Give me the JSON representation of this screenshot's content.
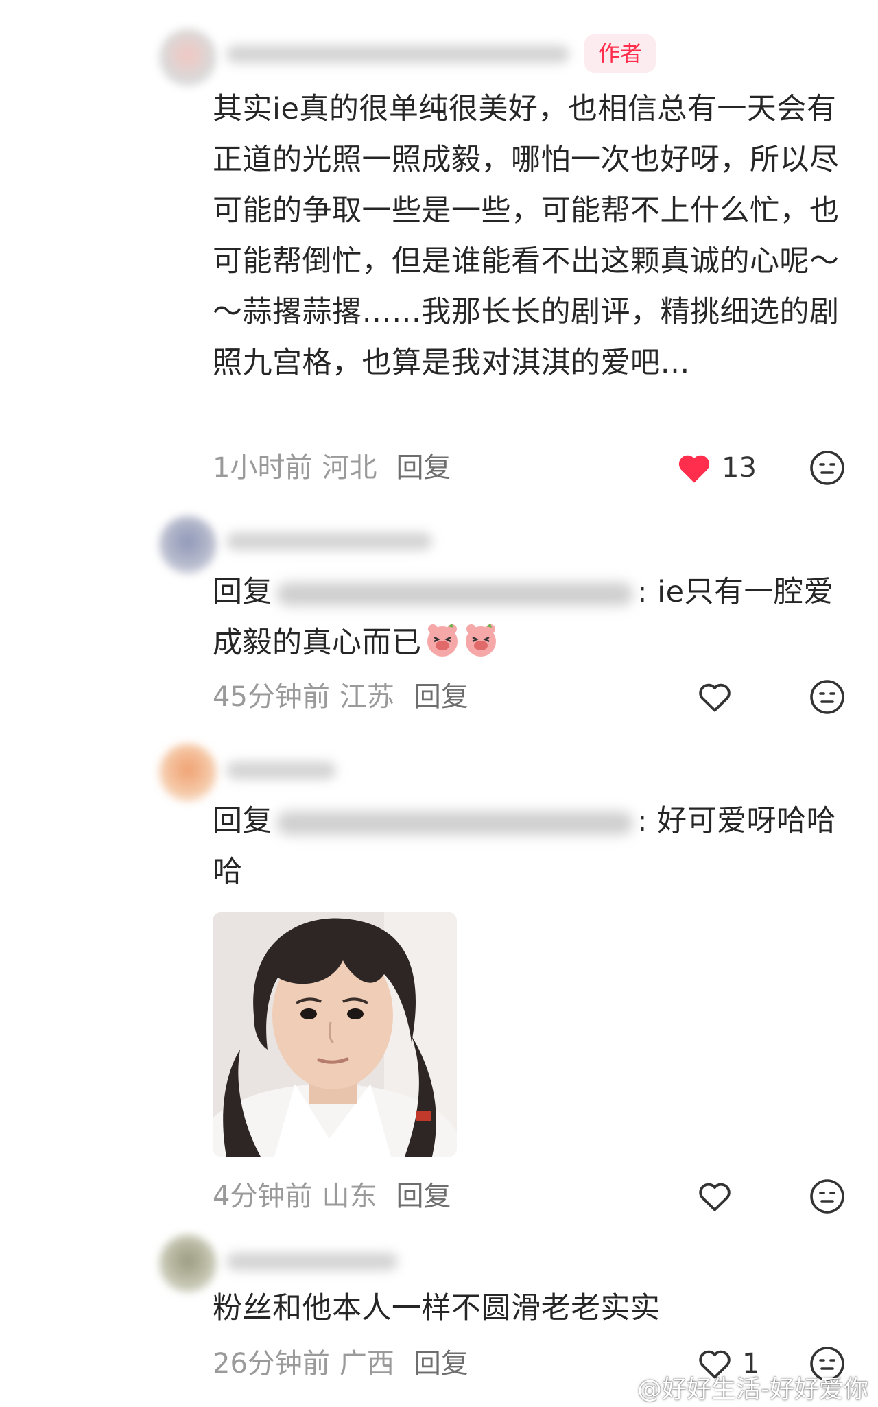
{
  "comments": [
    {
      "badge": "作者",
      "text": "其实ie真的很单纯很美好，也相信总有一天会有正道的光照一照成毅，哪怕一次也好呀，所以尽可能的争取一些是一些，可能帮不上什么忙，也可能帮倒忙，但是谁能看不出这颗真诚的心呢～～蒜撂蒜撂……我那长长的剧评，精挑细选的剧照九宫格，也算是我对淇淇的爱吧…",
      "time": "1小时前",
      "location": "河北",
      "reply_label": "回复",
      "likes": "13",
      "liked": true
    },
    {
      "reply_prefix": "回复",
      "text": ": ie只有一腔爱成毅的真心而已",
      "time": "45分钟前",
      "location": "江苏",
      "reply_label": "回复",
      "likes": "",
      "liked": false
    },
    {
      "reply_prefix": "回复",
      "text": ": 好可爱呀哈哈哈",
      "time": "4分钟前",
      "location": "山东",
      "reply_label": "回复",
      "likes": "",
      "liked": false
    },
    {
      "text": "粉丝和他本人一样不圆滑老老实实",
      "time": "26分钟前",
      "location": "广西",
      "reply_label": "回复",
      "likes": "1",
      "liked": false
    }
  ],
  "watermark": "@好好生活-好好爱你",
  "colors": {
    "author_badge": "#ff2e4d",
    "like_active": "#ff2e4d",
    "meta": "#9a9a9a"
  },
  "icons": {
    "like": "heart-icon",
    "emoji": "emoji-face-icon",
    "sticker": "laughing-pig-sticker",
    "weibo": "weibo-logo"
  }
}
